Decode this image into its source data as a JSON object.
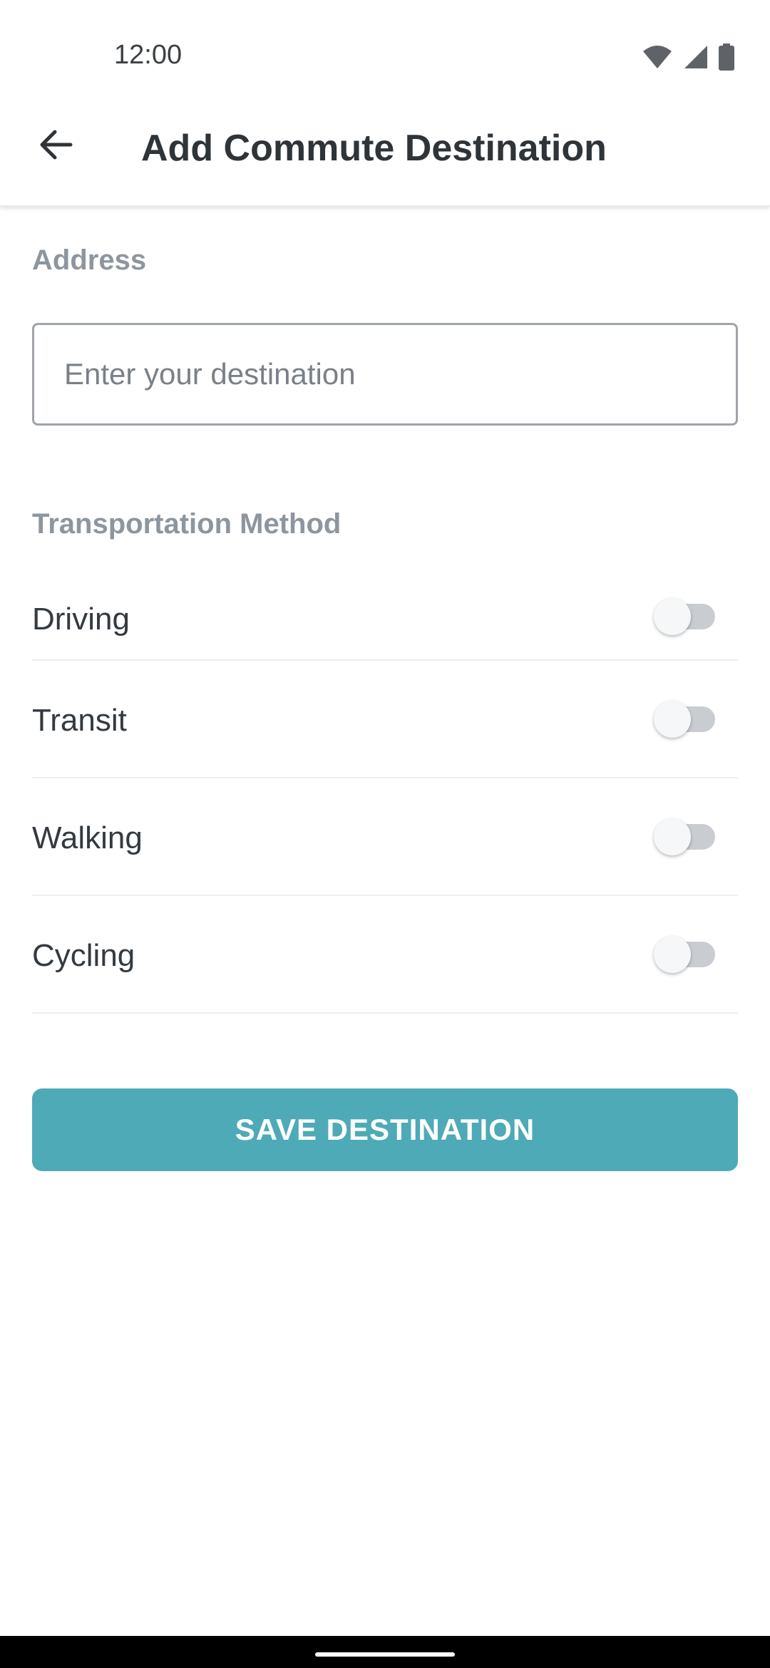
{
  "status_bar": {
    "time": "12:00",
    "icons": [
      "wifi-icon",
      "signal-icon",
      "battery-icon"
    ]
  },
  "app_bar": {
    "back_icon": "arrow-left-icon",
    "title": "Add Commute Destination"
  },
  "address": {
    "label": "Address",
    "value": "",
    "placeholder": "Enter your destination"
  },
  "transport": {
    "label": "Transportation Method",
    "methods": [
      {
        "label": "Driving",
        "enabled": false
      },
      {
        "label": "Transit",
        "enabled": false
      },
      {
        "label": "Walking",
        "enabled": false
      },
      {
        "label": "Cycling",
        "enabled": false
      }
    ]
  },
  "save_button": {
    "label": "SAVE DESTINATION"
  },
  "colors": {
    "accent": "#4eaab7",
    "section_label": "#8d969e",
    "text": "#333a40",
    "toggle_off_track": "#c9cdd1"
  }
}
